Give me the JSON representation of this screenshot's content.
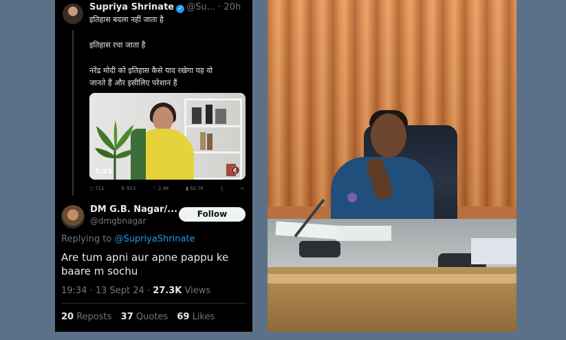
{
  "tweet": {
    "author_name": "Supriya Shrinate",
    "author_handle": "@Su...",
    "age": "· 20h",
    "lines": [
      "इतिहास बदला नहीं जाता है",
      "इतिहास रचा जाता है",
      "नरेंद्र मोदी को इतिहास कैसे याद रखेगा यह वो",
      "जानते हैं और इसीलिए परेशान हैं"
    ],
    "video_duration": "1:25",
    "metrics": {
      "replies": "711",
      "reposts": "923",
      "likes": "2.9K",
      "views": "50.7K"
    }
  },
  "reply": {
    "author_name": "DM G.B. Nagar/...",
    "author_handle": "@dmgbnagar",
    "follow_label": "Follow",
    "replying_prefix": "Replying to",
    "replying_to": "@SupriyaShrinate",
    "text": "Are tum apni aur apne pappu ke baare m sochu",
    "timestamp": "19:34 · 13 Sept 24 ·",
    "views_count": "27.3K",
    "views_label": "Views",
    "reposts_count": "20",
    "reposts_label": "Reposts",
    "quotes_count": "37",
    "quotes_label": "Quotes",
    "likes_count": "69",
    "likes_label": "Likes"
  },
  "icons": {
    "verified": "verified-badge-icon",
    "reply": "reply-icon",
    "repost": "repost-icon",
    "like": "heart-icon",
    "views": "bar-chart-icon",
    "bookmark": "bookmark-icon",
    "share": "share-icon",
    "mute": "volume-mute-icon"
  },
  "colors": {
    "tweet_bg": "#000000",
    "link_blue": "#1d9bf0",
    "muted_text": "#71767b",
    "page_bg": "#5c7088"
  }
}
